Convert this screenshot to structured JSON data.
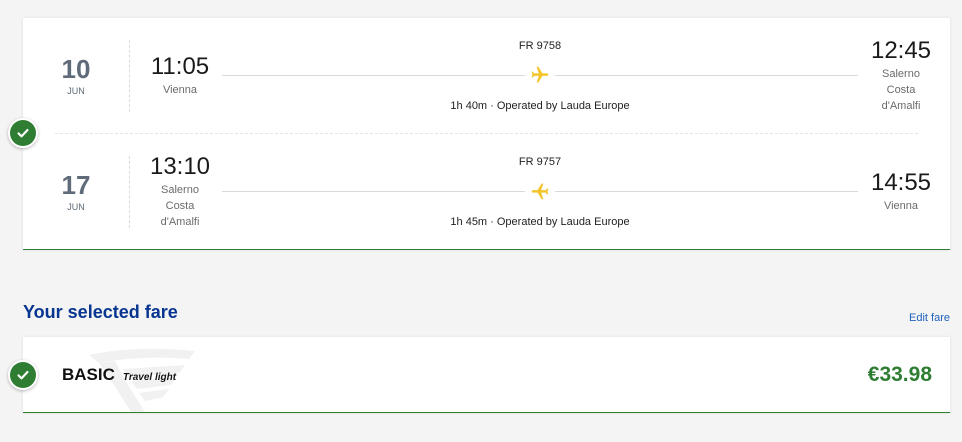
{
  "flights": [
    {
      "date": {
        "day": "10",
        "month": "JUN"
      },
      "departure": {
        "time": "11:05",
        "city": "Vienna"
      },
      "flight_number": "FR 9758",
      "details": "1h 40m · Operated by Lauda Europe",
      "arrival": {
        "time": "12:45",
        "city": "Salerno Costa d'Amalfi"
      },
      "icon": "plane-outbound-icon"
    },
    {
      "date": {
        "day": "17",
        "month": "JUN"
      },
      "departure": {
        "time": "13:10",
        "city": "Salerno Costa d'Amalfi"
      },
      "flight_number": "FR 9757",
      "details": "1h 45m · Operated by Lauda Europe",
      "arrival": {
        "time": "14:55",
        "city": "Vienna"
      },
      "icon": "plane-return-icon"
    }
  ],
  "flights_status_icon": "check-circle-icon",
  "fare": {
    "heading": "Your selected fare",
    "edit_label": "Edit fare",
    "name": "BASIC",
    "tagline": "Travel light",
    "price": "€33.98",
    "status_icon": "check-circle-icon",
    "watermark_icon": "harp-logo-icon"
  },
  "colors": {
    "page_background": "#f4f4f4",
    "card_background": "#ffffff",
    "accent_green": "#2f7d32",
    "heading_blue": "#073590",
    "link_blue": "#1f5fbf",
    "plane_yellow": "#f2c52d",
    "date_gray": "#5f6b78",
    "muted_text": "#6b6b6b"
  }
}
